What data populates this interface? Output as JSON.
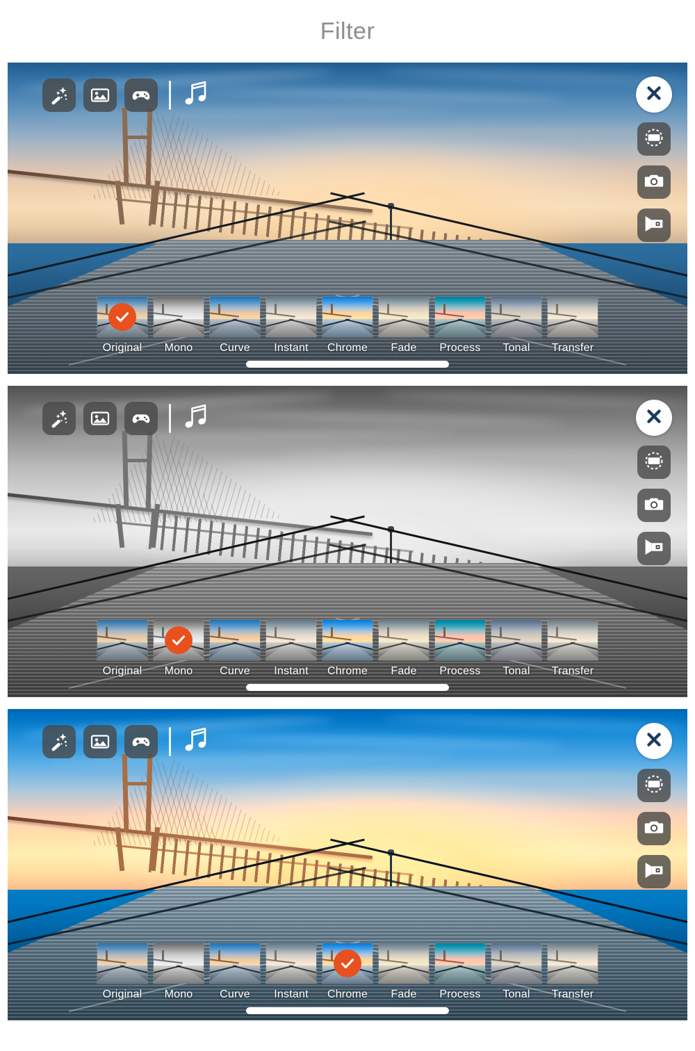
{
  "header": {
    "title": "Filter"
  },
  "colors": {
    "accent": "#e8501e",
    "toolbar_button_bg": "rgba(72,72,72,0.80)",
    "label_text": "#ffffff",
    "title_text": "#8d8d8d"
  },
  "toolbar_left": {
    "buttons": [
      {
        "name": "magic-wand-icon",
        "label": "Effects"
      },
      {
        "name": "image-icon",
        "label": "Photo"
      },
      {
        "name": "game-controller-icon",
        "label": "Game"
      }
    ],
    "divider": "|",
    "music": {
      "name": "music-note-icon",
      "label": "Music"
    }
  },
  "toolbar_right": {
    "buttons": [
      {
        "name": "close-icon",
        "label": "Close"
      },
      {
        "name": "rotate-frame-icon",
        "label": "Rotate"
      },
      {
        "name": "camera-icon",
        "label": "Photo Capture"
      },
      {
        "name": "video-camera-icon",
        "label": "Video Capture"
      }
    ]
  },
  "filters": [
    {
      "id": "original",
      "label": "Original"
    },
    {
      "id": "mono",
      "label": "Mono"
    },
    {
      "id": "curve",
      "label": "Curve"
    },
    {
      "id": "instant",
      "label": "Instant"
    },
    {
      "id": "chrome",
      "label": "Chrome"
    },
    {
      "id": "fade",
      "label": "Fade"
    },
    {
      "id": "process",
      "label": "Process"
    },
    {
      "id": "tonal",
      "label": "Tonal"
    },
    {
      "id": "transfer",
      "label": "Transfer"
    }
  ],
  "panels": [
    {
      "index": 1,
      "selected_filter": "original",
      "selected_label": "Original",
      "preview_mode": "original"
    },
    {
      "index": 2,
      "selected_filter": "mono",
      "selected_label": "Mono",
      "preview_mode": "mono"
    },
    {
      "index": 3,
      "selected_filter": "chrome",
      "selected_label": "Chrome",
      "preview_mode": "chrome"
    }
  ]
}
